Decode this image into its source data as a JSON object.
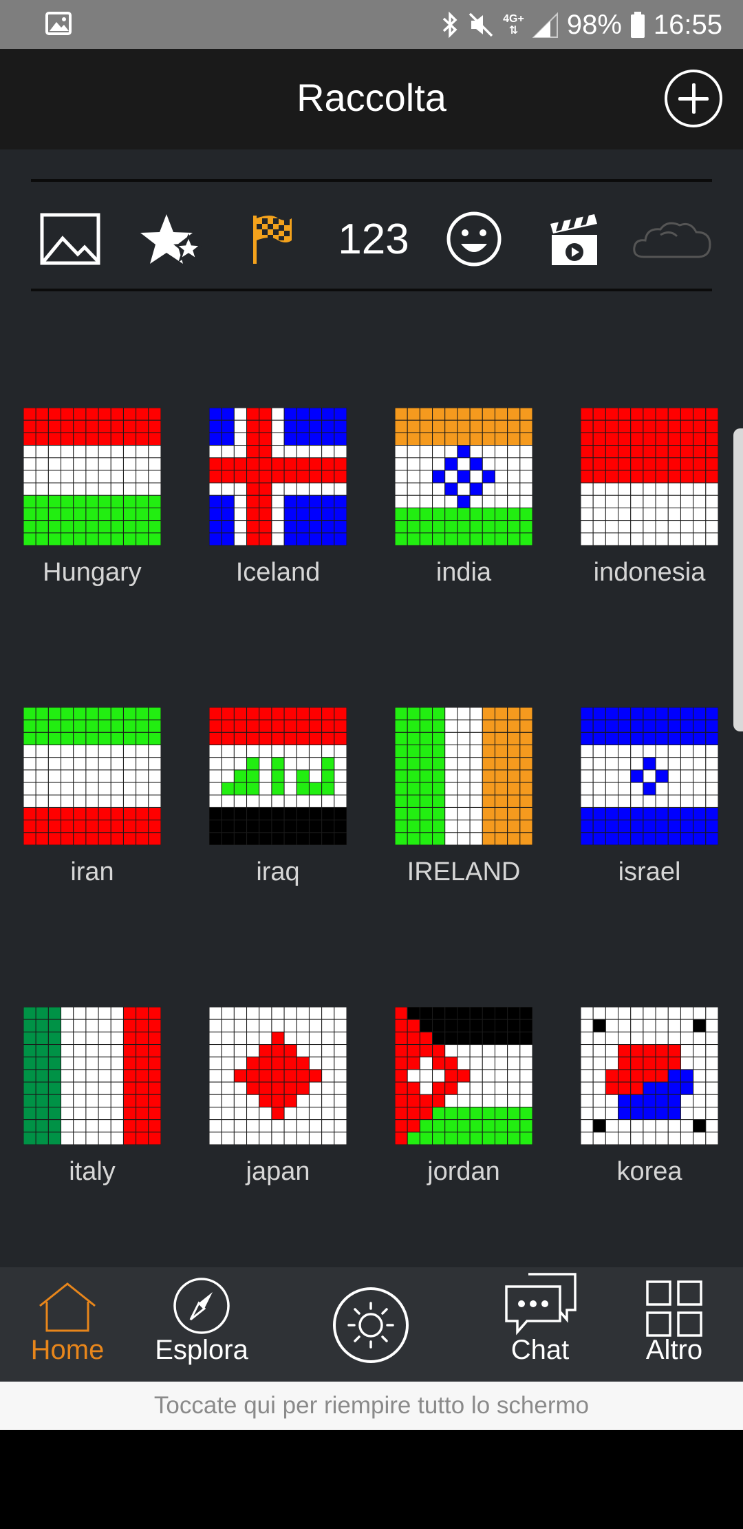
{
  "status_bar": {
    "network": "4G+",
    "battery": "98%",
    "time": "16:55"
  },
  "header": {
    "title": "Raccolta"
  },
  "categories": [
    {
      "icon": "image-icon"
    },
    {
      "icon": "stars-icon"
    },
    {
      "icon": "checkered-flag-icon",
      "active": true,
      "color": "#f4a21c"
    },
    {
      "label": "123"
    },
    {
      "icon": "smiley-icon"
    },
    {
      "icon": "clapperboard-icon"
    },
    {
      "icon": "cloud-icon"
    }
  ],
  "flags": [
    {
      "label": "Hungary"
    },
    {
      "label": "Iceland"
    },
    {
      "label": "india"
    },
    {
      "label": "indonesia"
    },
    {
      "label": "iran"
    },
    {
      "label": "iraq"
    },
    {
      "label": "IRELAND"
    },
    {
      "label": "israel"
    },
    {
      "label": "italy"
    },
    {
      "label": "japan"
    },
    {
      "label": "jordan"
    },
    {
      "label": "korea"
    }
  ],
  "bottom_nav": {
    "home": "Home",
    "explore": "Esplora",
    "chat": "Chat",
    "more": "Altro"
  },
  "fullscreen_hint": "Toccate qui per riempire tutto lo schermo",
  "colors": {
    "accent": "#e8861b",
    "red": "#ff0000",
    "green": "#22ee11",
    "blue": "#0000ff",
    "orange": "#f59a1e",
    "black": "#000000",
    "white": "#ffffff",
    "italy_green": "#009246"
  }
}
